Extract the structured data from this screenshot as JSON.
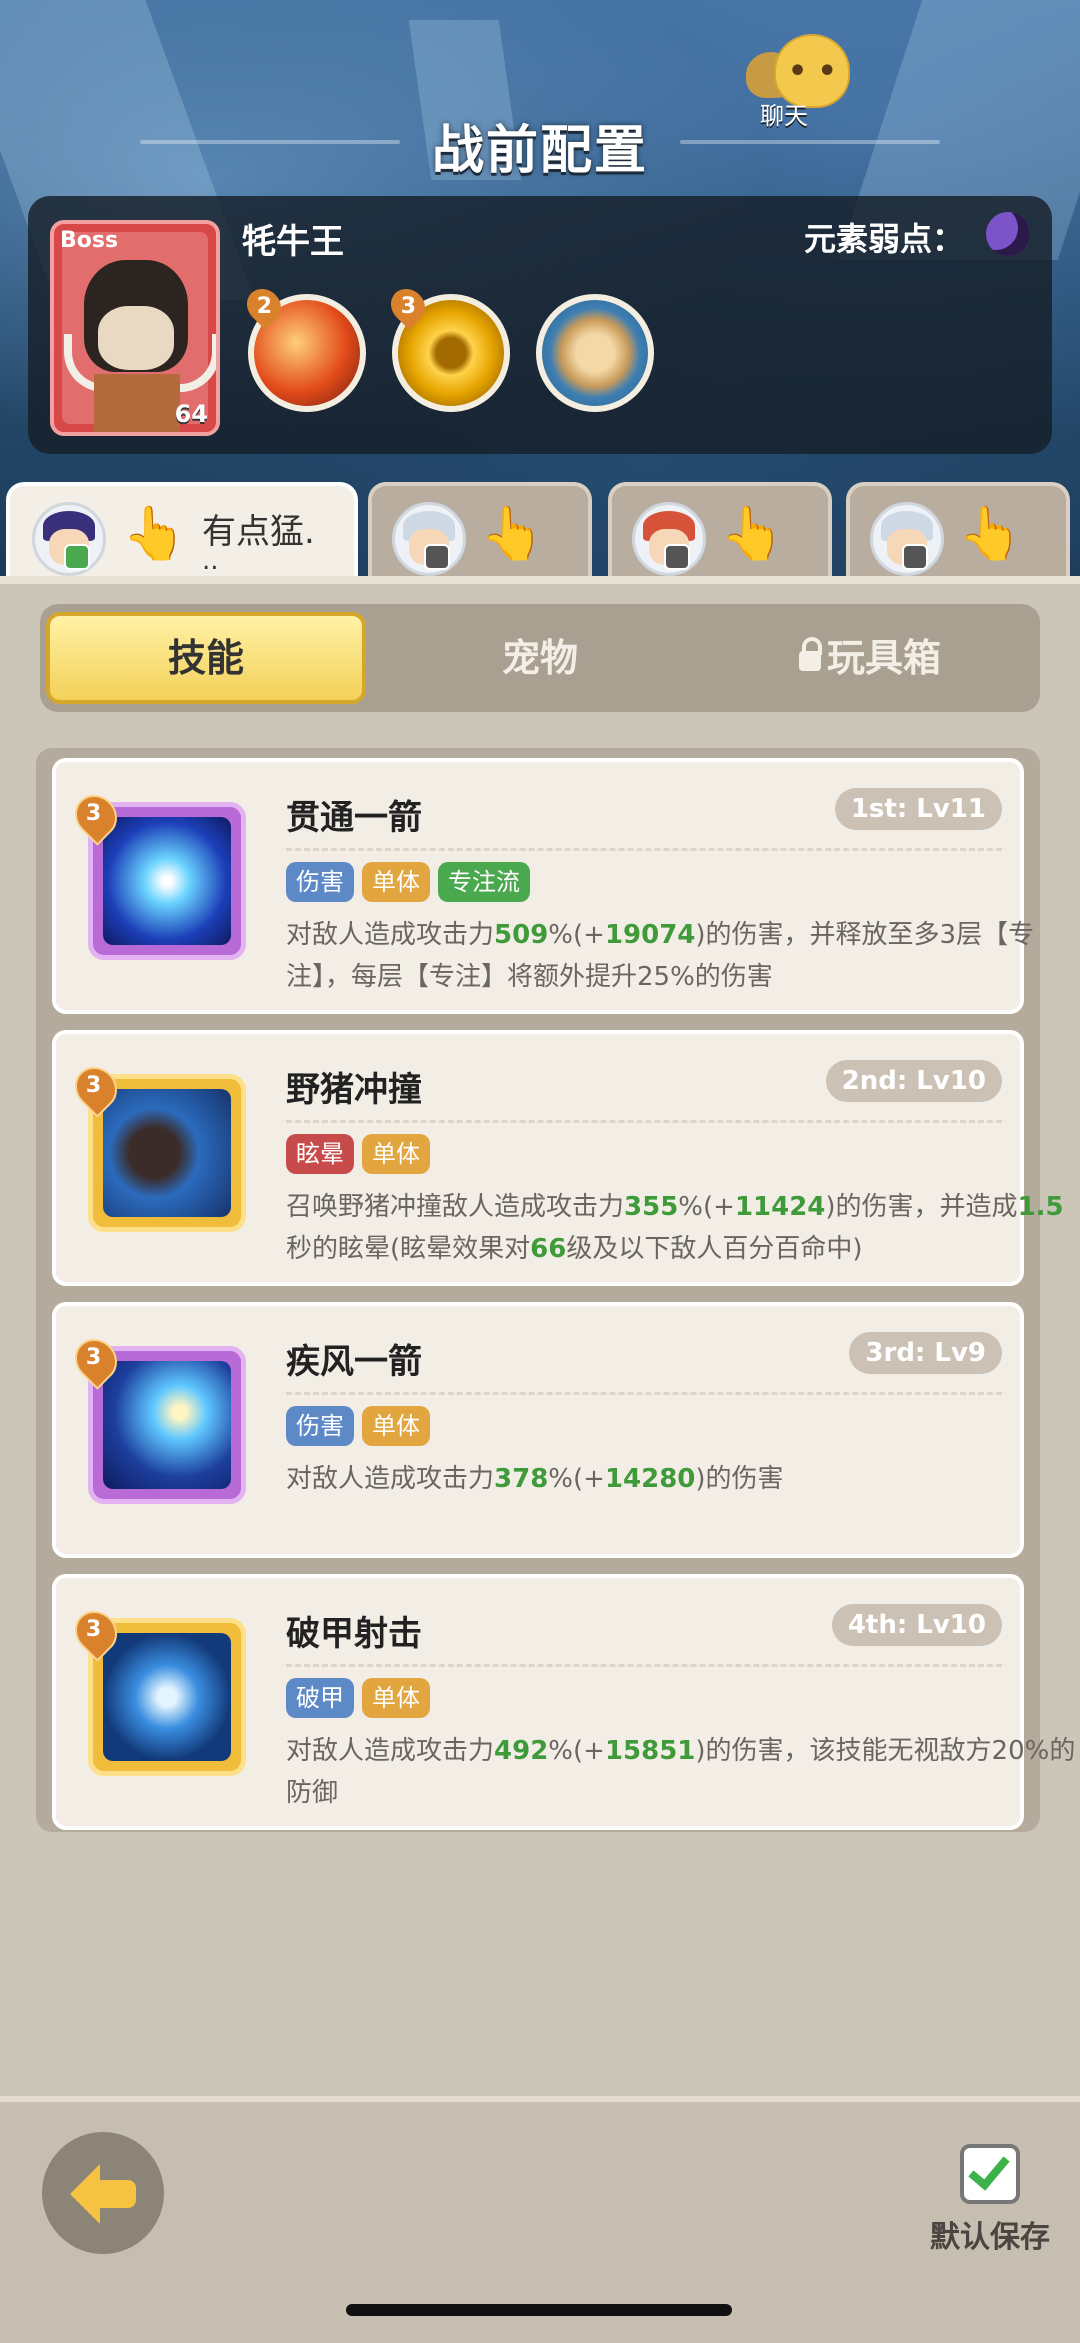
{
  "header": {
    "title": "战前配置",
    "chat_label": "聊天"
  },
  "boss": {
    "tag": "Boss",
    "level": "64",
    "name": "牦牛王",
    "weakness_label": "元素弱点：",
    "skills": [
      {
        "icon": "fire-burst-icon",
        "level": "2"
      },
      {
        "icon": "golden-ring-icon",
        "level": "3"
      },
      {
        "icon": "rock-shield-icon",
        "level": ""
      }
    ]
  },
  "heroes": [
    {
      "name": "有点猛.",
      "name2": "..",
      "active": true
    },
    {
      "name": "",
      "active": false
    },
    {
      "name": "",
      "active": false
    },
    {
      "name": "",
      "active": false
    }
  ],
  "tabs": {
    "skills": "技能",
    "pets": "宠物",
    "toybox": "玩具箱"
  },
  "skills": [
    {
      "name": "贯通一箭",
      "order": "1st: Lv11",
      "level": "3",
      "tags": [
        "伤害",
        "单体",
        "专注流"
      ],
      "desc": [
        "对敌人造成攻击力",
        "509",
        "%(+",
        "19074",
        ")的伤害，并释放至多3层【专注】，每层【专注】将额外提升25%的伤害"
      ]
    },
    {
      "name": "野猪冲撞",
      "order": "2nd: Lv10",
      "level": "3",
      "tags": [
        "眩晕",
        "单体"
      ],
      "desc": [
        "召唤野猪冲撞敌人造成攻击力",
        "355",
        "%(+",
        "11424",
        ")的伤害，并造成",
        "1.5",
        "秒的眩晕(眩晕效果对",
        "66",
        "级及以下敌人百分百命中)"
      ]
    },
    {
      "name": "疾风一箭",
      "order": "3rd: Lv9",
      "level": "3",
      "tags": [
        "伤害",
        "单体"
      ],
      "desc": [
        "对敌人造成攻击力",
        "378",
        "%(+",
        "14280",
        ")的伤害"
      ]
    },
    {
      "name": "破甲射击",
      "order": "4th: Lv10",
      "level": "3",
      "tags": [
        "破甲",
        "单体"
      ],
      "desc": [
        "对敌人造成攻击力",
        "492",
        "%(+",
        "15851",
        ")的伤害，该技能无视敌方20%的防御"
      ]
    }
  ],
  "footer": {
    "save_label": "默认保存"
  }
}
